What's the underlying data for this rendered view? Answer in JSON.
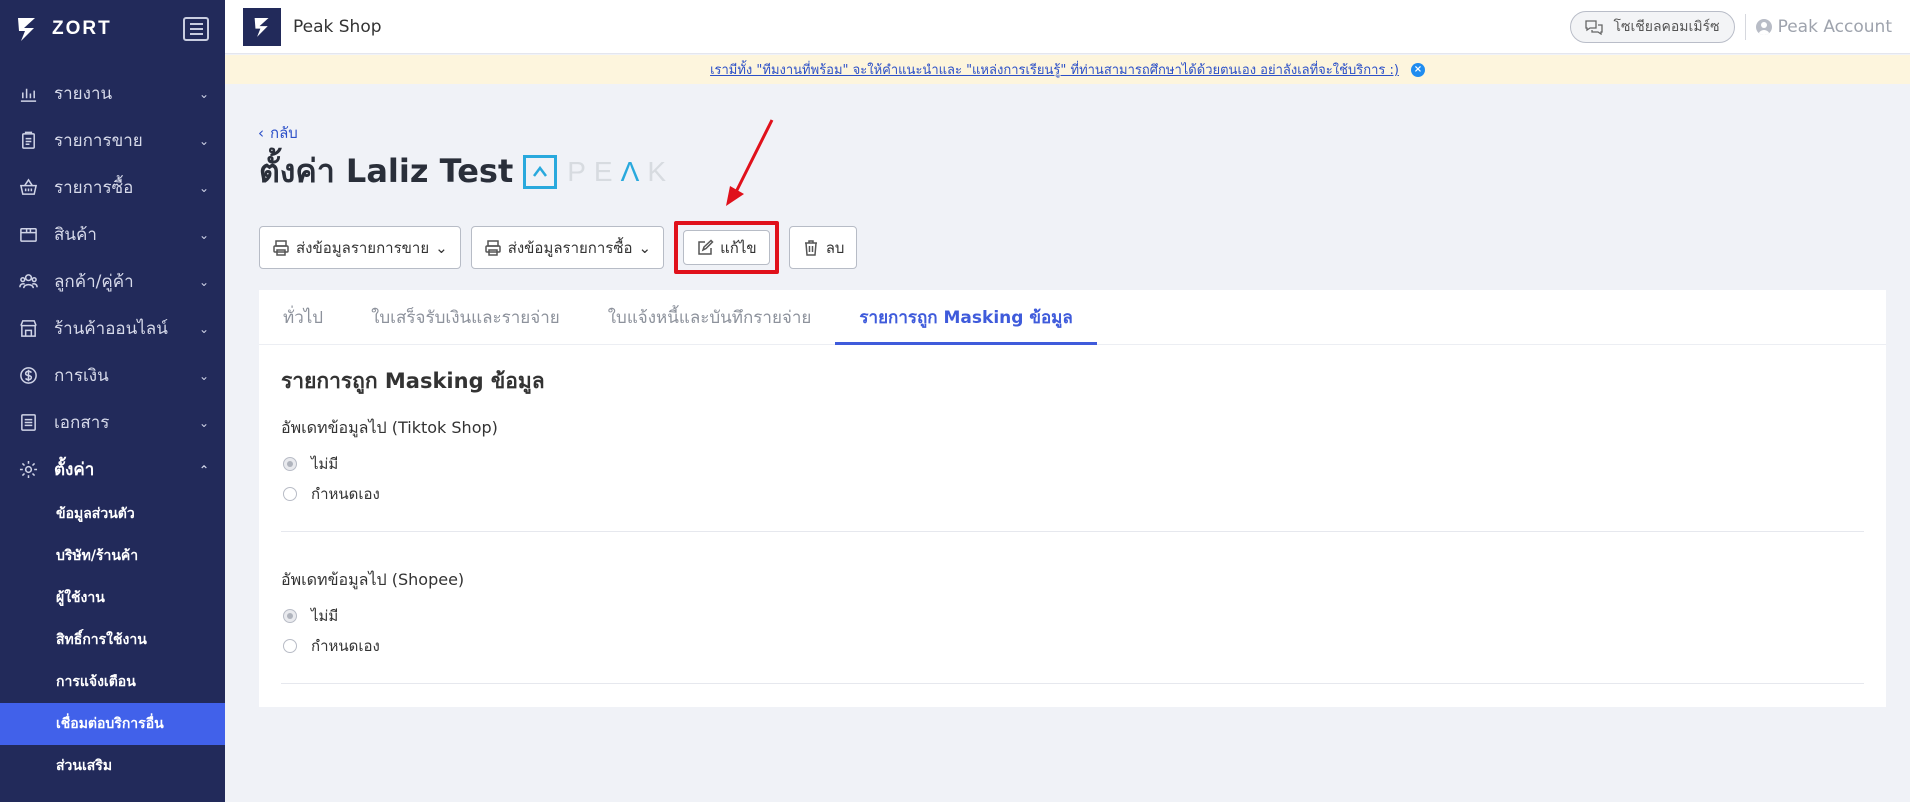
{
  "sidebar": {
    "brand": "ZORT",
    "items": [
      {
        "label": "รายงาน",
        "icon": "chart-bar-icon"
      },
      {
        "label": "รายการขาย",
        "icon": "clipboard-icon"
      },
      {
        "label": "รายการซื้อ",
        "icon": "basket-icon"
      },
      {
        "label": "สินค้า",
        "icon": "box-icon"
      },
      {
        "label": "ลูกค้า/คู่ค้า",
        "icon": "users-icon"
      },
      {
        "label": "ร้านค้าออนไลน์",
        "icon": "store-icon"
      },
      {
        "label": "การเงิน",
        "icon": "dollar-icon"
      },
      {
        "label": "เอกสาร",
        "icon": "document-icon"
      },
      {
        "label": "ตั้งค่า",
        "icon": "gear-icon"
      }
    ],
    "settings_sub": [
      "ข้อมูลส่วนตัว",
      "บริษัท/ร้านค้า",
      "ผู้ใช้งาน",
      "สิทธิ์การใช้งาน",
      "การแจ้งเตือน",
      "เชื่อมต่อบริการอื่น",
      "ส่วนเสริม"
    ]
  },
  "topbar": {
    "shop_name": "Peak Shop",
    "social_commerce": "โซเชียลคอมเมิร์ซ",
    "account": "Peak Account"
  },
  "banner": {
    "text": "เรามีทั้ง \"ทีมงานที่พร้อม\" จะให้คำแนะนำและ \"แหล่งการเรียนรู้\" ที่ท่านสามารถศึกษาได้ด้วยตนเอง อย่าลังเลที่จะใช้บริการ :)",
    "close": "×"
  },
  "page": {
    "back": "กลับ",
    "title": "ตั้งค่า Laliz Test",
    "peak_logo_text": "PEAK"
  },
  "actions": {
    "send_sales": "ส่งข้อมูลรายการขาย",
    "send_purchases": "ส่งข้อมูลรายการซื้อ",
    "edit": "แก้ไข",
    "delete": "ลบ"
  },
  "tabs": [
    "ทั่วไป",
    "ใบเสร็จรับเงินและรายจ่าย",
    "ใบแจ้งหนี้และบันทึกรายจ่าย",
    "รายการถูก Masking ข้อมูล"
  ],
  "content": {
    "title": "รายการถูก Masking ข้อมูล",
    "groups": [
      {
        "label": "อัพเดทข้อมูลไป (Tiktok Shop)",
        "options": [
          "ไม่มี",
          "กำหนดเอง"
        ],
        "selected": "ไม่มี"
      },
      {
        "label": "อัพเดทข้อมูลไป (Shopee)",
        "options": [
          "ไม่มี",
          "กำหนดเอง"
        ],
        "selected": "ไม่มี"
      }
    ]
  },
  "colors": {
    "sidebar_bg": "#222a5a",
    "accent": "#4161ea",
    "highlight": "#e0111b",
    "banner_bg": "#fdf5dd"
  }
}
